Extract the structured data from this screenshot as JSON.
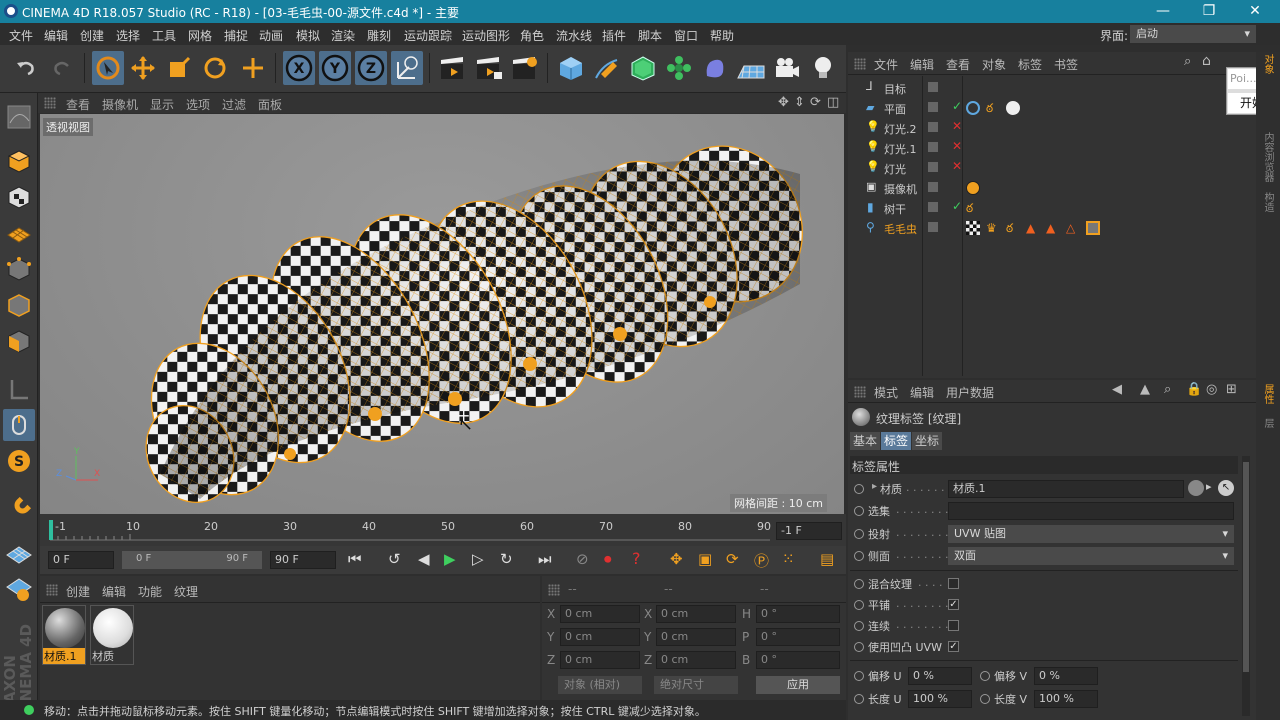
{
  "app": {
    "title": "CINEMA 4D R18.057 Studio (RC - R18) - [03-毛毛虫-00-源文件.c4d *] - 主要",
    "window_controls": [
      "minimize-icon",
      "restore-icon",
      "close-icon"
    ]
  },
  "menu": {
    "items": [
      "文件",
      "编辑",
      "创建",
      "选择",
      "工具",
      "网格",
      "捕捉",
      "动画",
      "模拟",
      "渲染",
      "雕刻",
      "运动跟踪",
      "运动图形",
      "角色",
      "流水线",
      "插件",
      "脚本",
      "窗口",
      "帮助"
    ],
    "layout_label": "界面:",
    "layout_value": "启动"
  },
  "toolbar": {
    "icons": [
      "undo-icon",
      "redo-icon",
      "live-select-icon",
      "move-icon",
      "scale-icon",
      "rotate-icon",
      "recent-tool-icon",
      "x-axis-icon",
      "y-axis-icon",
      "z-axis-icon",
      "coordinate-system-icon",
      "render-view-icon",
      "render-picture-viewer-icon",
      "render-settings-icon",
      "cube-icon",
      "pen-icon",
      "subdivision-icon",
      "cloner-icon",
      "deformer-icon",
      "floor-icon",
      "camera-icon",
      "light-icon"
    ],
    "axis_labels": [
      "X",
      "Y",
      "Z"
    ]
  },
  "viewport": {
    "menu": [
      "查看",
      "摄像机",
      "显示",
      "选项",
      "过滤",
      "面板"
    ],
    "label": "透视视图",
    "grid_spacing": "网格间距 : 10 cm",
    "axis": {
      "x": "X",
      "y": "Y",
      "z": "Z"
    }
  },
  "timeline": {
    "ticks": [
      "-1",
      "10",
      "20",
      "30",
      "40",
      "50",
      "60",
      "70",
      "80",
      "90"
    ],
    "current_frame": "-1 F"
  },
  "transport": {
    "start": "0 F",
    "range_start": "0 F",
    "range_end": "90 F",
    "end": "90 F"
  },
  "materials": {
    "menu": [
      "创建",
      "编辑",
      "功能",
      "纹理"
    ],
    "items": [
      {
        "name": "材质.1",
        "selected": true
      },
      {
        "name": "材质",
        "selected": false
      }
    ]
  },
  "coords": {
    "headers": [
      "--",
      "--",
      "--"
    ],
    "rows": [
      {
        "a": "X",
        "av": "0 cm",
        "b": "X",
        "bv": "0 cm",
        "c": "H",
        "cv": "0 °"
      },
      {
        "a": "Y",
        "av": "0 cm",
        "b": "Y",
        "bv": "0 cm",
        "c": "P",
        "cv": "0 °"
      },
      {
        "a": "Z",
        "av": "0 cm",
        "b": "Z",
        "bv": "0 cm",
        "c": "B",
        "cv": "0 °"
      }
    ],
    "mode": "对象 (相对)",
    "size_mode": "绝对尺寸",
    "apply": "应用"
  },
  "status": {
    "text": "移动：点击并拖动鼠标移动元素。按住 SHIFT 键量化移动；节点编辑模式时按住 SHIFT 键增加选择对象；按住 CTRL 键减少选择对象。"
  },
  "objects": {
    "menu": [
      "文件",
      "编辑",
      "查看",
      "对象",
      "标签",
      "书签"
    ],
    "items": [
      {
        "name": "目标",
        "icon": "target-icon",
        "status": "none",
        "tags": []
      },
      {
        "name": "平面",
        "icon": "plane-icon",
        "status": "check",
        "tags": [
          "target-tag-icon",
          "material-tag-icon",
          "material-tag-icon"
        ]
      },
      {
        "name": "灯光.2",
        "icon": "light-icon",
        "status": "x",
        "tags": []
      },
      {
        "name": "灯光.1",
        "icon": "light-icon",
        "status": "x",
        "tags": []
      },
      {
        "name": "灯光",
        "icon": "light-icon",
        "status": "x",
        "tags": []
      },
      {
        "name": "摄像机",
        "icon": "camera-icon",
        "status": "none",
        "tags": [
          "protection-tag-icon"
        ]
      },
      {
        "name": "树干",
        "icon": "cylinder-icon",
        "status": "check",
        "tags": [
          "phong-tag-icon"
        ]
      },
      {
        "name": "毛毛虫",
        "icon": "joint-icon",
        "status": "none",
        "tags": [
          "texture-tag-icon",
          "weight-tag-icon",
          "phong-tag-icon",
          "pose-tag-icon",
          "pose-tag-icon",
          "pose-tag-icon",
          "material-tag-icon"
        ]
      }
    ]
  },
  "popup": {
    "field": "Poi...",
    "button": "开始"
  },
  "attributes": {
    "menu": [
      "模式",
      "编辑",
      "用户数据"
    ],
    "title": "纹理标签 [纹理]",
    "tabs": [
      "基本",
      "标签",
      "坐标"
    ],
    "section": "标签属性",
    "material_label": "材质",
    "material_value": "材质.1",
    "selection_label": "选集",
    "projection_label": "投射",
    "projection_value": "UVW 贴图",
    "side_label": "侧面",
    "side_value": "双面",
    "mix_label": "混合纹理",
    "mix_checked": false,
    "tile_label": "平铺",
    "tile_checked": true,
    "seamless_label": "连续",
    "seamless_checked": false,
    "bump_label": "使用凹凸 UVW",
    "bump_checked": true,
    "offset_u_label": "偏移 U",
    "offset_u": "0 %",
    "offset_v_label": "偏移 V",
    "offset_v": "0 %",
    "length_u_label": "长度 U",
    "length_u": "100 %",
    "length_v_label": "长度 V",
    "length_v": "100 %"
  },
  "side_tabs": [
    "对象",
    "内容浏览器",
    "构造",
    "属性",
    "层"
  ],
  "colors": {
    "titlebar": "#17809e",
    "accent_orange": "#f0a020",
    "highlight_blue": "#4d6e8c",
    "panel": "#333333"
  }
}
